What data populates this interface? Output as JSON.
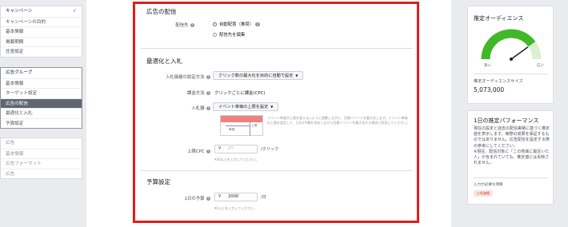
{
  "sidebar": {
    "campaign": [
      {
        "label": "キャンペーン",
        "checked": true
      },
      {
        "label": "キャンペーンの目的"
      },
      {
        "label": "基本情報"
      },
      {
        "label": "掲載期間"
      },
      {
        "label": "任意設定"
      }
    ],
    "adgroup": [
      {
        "label": "広告グループ"
      },
      {
        "label": "基本情報"
      },
      {
        "label": "ターゲット設定"
      },
      {
        "label": "広告の配信",
        "active": true
      },
      {
        "label": "最適化と入札"
      },
      {
        "label": "予算設定"
      }
    ],
    "ad": [
      {
        "label": "広告"
      },
      {
        "label": "基本情報"
      },
      {
        "label": "広告フォーマット"
      },
      {
        "label": "広告"
      }
    ]
  },
  "placement": {
    "title": "広告の配信",
    "label": "配信先",
    "option_auto": "自動配置（推奨）",
    "option_edit": "配信先を編集"
  },
  "bidding": {
    "title": "最適化と入札",
    "strategy_label": "入札価格の設定方法",
    "strategy_value": "クリック数の最大化を目的に自動で設定",
    "charge_label": "課金方法",
    "charge_value": "クリックごとに課金(CPC)",
    "amount_label": "入札額",
    "amount_value": "イベント単価の上限を設定",
    "box_t1": "単価",
    "box_t2": "上限",
    "info": "イベント単価が上限を超えないように調整しながら、目標イベントを最大化します。イベント単価の上限を設定して、1日の予算を消化しながら目標イベントを最大化する場合に利用してください。",
    "cpc_label": "上限CPC",
    "currency": "¥",
    "cpc_placeholder": "JPY",
    "cpc_unit": "/クリック",
    "cpc_hint": "¥36以上を入力してください。"
  },
  "budget": {
    "title": "予算設定",
    "daily_label": "1日の予算",
    "currency": "¥",
    "daily_value": "2000",
    "daily_unit": "/日",
    "daily_hint": "¥1以上を入力してください。"
  },
  "audience": {
    "title": "推定オーディエンス",
    "narrow": "狭い",
    "wide": "広い",
    "size_label": "推定オーディエンスサイズ",
    "size_value": "5,073,000",
    "gauge_level": 0.8,
    "gauge_color": "#42b72a"
  },
  "performance": {
    "title": "1日の推定パフォーマンス",
    "desc": "現在の設定と過去の配信実績に基づく推定値を表示します。実際の成果を保証するものではありません。広告配信を設定する際の参考にしてください。\n※現在、配信対象に「この地域に最近いた人」が含まれていても、推定値には反映されません。",
    "required_label": "入力が必要な項目",
    "required_tag": "入札価格"
  }
}
